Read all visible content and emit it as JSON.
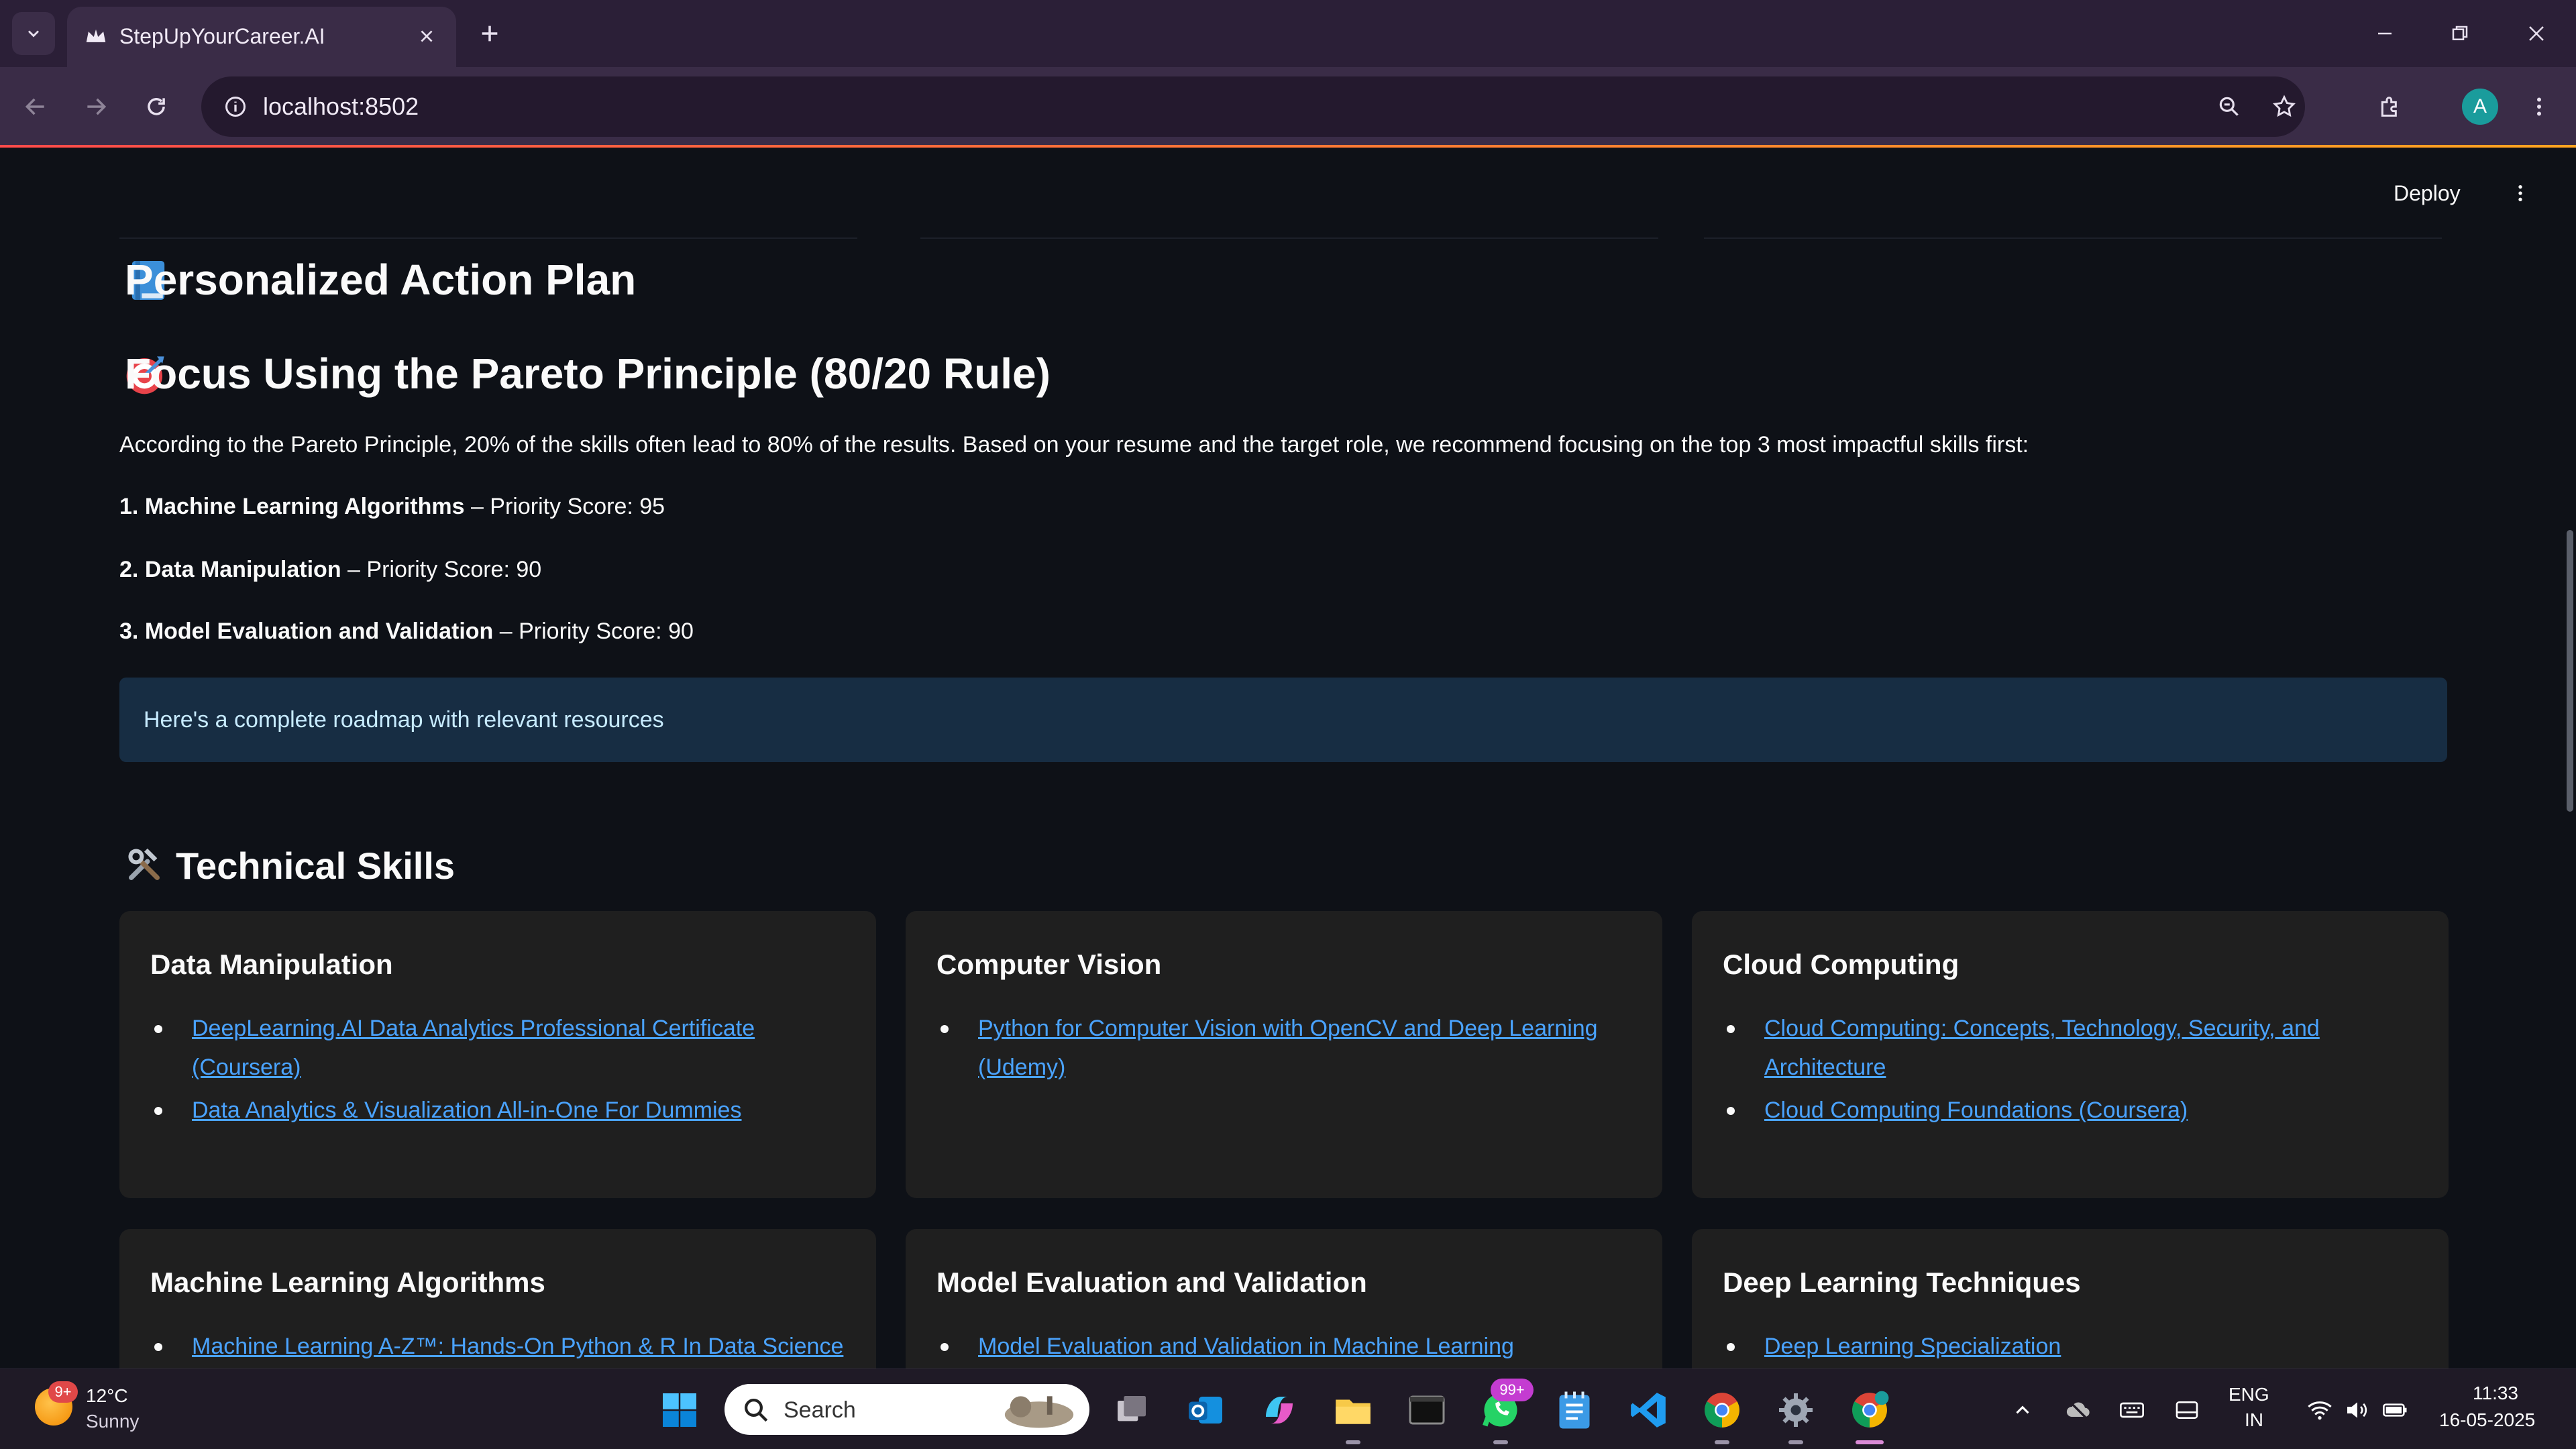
{
  "browser": {
    "tab_title": "StepUpYourCareer.AI",
    "url": "localhost:8502"
  },
  "app": {
    "deploy_label": "Deploy",
    "action_plan_title": "Personalized Action Plan",
    "pareto_title": "Focus Using the Pareto Principle (80/20 Rule)",
    "pareto_intro": "According to the Pareto Principle, 20% of the skills often lead to 80% of the results. Based on your resume and the target role, we recommend focusing on the top 3 most impactful skills first:",
    "priorities": [
      {
        "rank": "1.",
        "skill": "Machine Learning Algorithms",
        "score": " – Priority Score: 95"
      },
      {
        "rank": "2.",
        "skill": "Data Manipulation",
        "score": " – Priority Score: 90"
      },
      {
        "rank": "3.",
        "skill": "Model Evaluation and Validation",
        "score": " – Priority Score: 90"
      }
    ],
    "info_message": "Here's a complete roadmap with relevant resources",
    "technical_skills_title": "Technical Skills",
    "cards": [
      {
        "title": "Data Manipulation",
        "links": [
          "DeepLearning.AI Data Analytics Professional Certificate (Coursera)",
          "Data Analytics & Visualization All-in-One For Dummies"
        ]
      },
      {
        "title": "Computer Vision",
        "links": [
          "Python for Computer Vision with OpenCV and Deep Learning (Udemy)"
        ]
      },
      {
        "title": "Cloud Computing",
        "links": [
          "Cloud Computing: Concepts, Technology, Security, and Architecture",
          "Cloud Computing Foundations (Coursera)"
        ]
      },
      {
        "title": "Machine Learning Algorithms",
        "links": [
          "Machine Learning A-Z™: Hands-On Python & R In Data Science"
        ]
      },
      {
        "title": "Model Evaluation and Validation",
        "links": [
          "Model Evaluation and Validation in Machine Learning"
        ]
      },
      {
        "title": "Deep Learning Techniques",
        "links": [
          "Deep Learning Specialization"
        ]
      }
    ]
  },
  "taskbar": {
    "weather_badge": "9+",
    "weather_temp": "12°C",
    "weather_cond": "Sunny",
    "search_label": "Search",
    "whatsapp_badge": "99+",
    "lang_top": "ENG",
    "lang_bottom": "IN",
    "time": "11:33",
    "date": "16-05-2025"
  },
  "colors": {
    "background": "#0e1117",
    "link": "#4aa3ff",
    "info_bg": "#172d43",
    "card_bg": "#1f1f1f"
  }
}
